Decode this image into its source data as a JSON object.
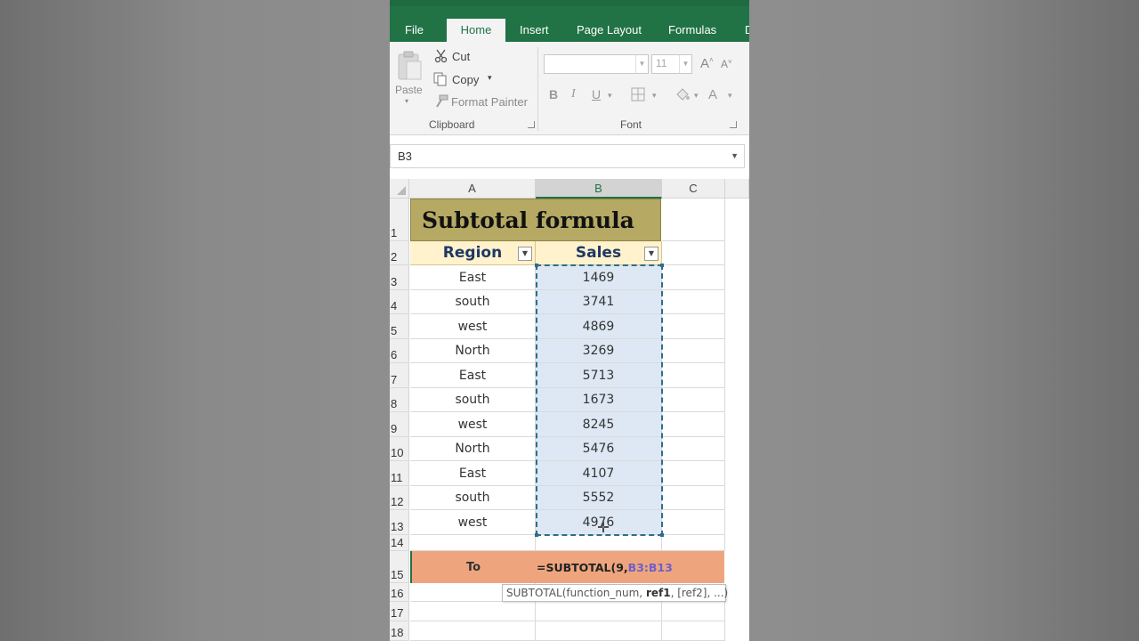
{
  "ribbon": {
    "tabs": [
      "File",
      "Home",
      "Insert",
      "Page Layout",
      "Formulas",
      "D"
    ],
    "active_tab": "Home",
    "clipboard": {
      "paste_label": "Paste",
      "cut_label": "Cut",
      "copy_label": "Copy",
      "format_painter_label": "Format Painter",
      "group_label": "Clipboard"
    },
    "font": {
      "font_name": "",
      "font_size": "11",
      "bold": "B",
      "italic": "I",
      "underline": "U",
      "grow": "A",
      "shrink": "A",
      "font_color": "A",
      "group_label": "Font"
    }
  },
  "name_box": {
    "value": "B3"
  },
  "sheet": {
    "columns": [
      "A",
      "B",
      "C"
    ],
    "selected_column": "B",
    "rows": [
      "1",
      "2",
      "3",
      "4",
      "5",
      "6",
      "7",
      "8",
      "9",
      "10",
      "11",
      "12",
      "13",
      "14",
      "15",
      "16",
      "17",
      "18"
    ],
    "title": "Subtotal formula",
    "headers": {
      "region": "Region",
      "sales": "Sales"
    },
    "data": [
      {
        "region": "East",
        "sales": "1469"
      },
      {
        "region": "south",
        "sales": "3741"
      },
      {
        "region": "west",
        "sales": "4869"
      },
      {
        "region": "North",
        "sales": "3269"
      },
      {
        "region": "East",
        "sales": "5713"
      },
      {
        "region": "south",
        "sales": "1673"
      },
      {
        "region": "west",
        "sales": "8245"
      },
      {
        "region": "North",
        "sales": "5476"
      },
      {
        "region": "East",
        "sales": "4107"
      },
      {
        "region": "south",
        "sales": "5552"
      },
      {
        "region": "west",
        "sales": "4976"
      }
    ],
    "total_label": "To",
    "formula_prefix": "=SUBTOTAL(9,",
    "formula_ref": "B3:B13",
    "tooltip": {
      "func": "SUBTOTAL(function_num, ",
      "arg_bold": "ref1",
      "rest": ", [ref2], ...)"
    }
  },
  "colors": {
    "excel_green": "#217346",
    "title_fill": "#b5a963",
    "header_fill": "#fff2cc",
    "total_fill": "#eea57e",
    "selection_fill": "#dde8f4",
    "formula_ref": "#6e5fc9"
  }
}
